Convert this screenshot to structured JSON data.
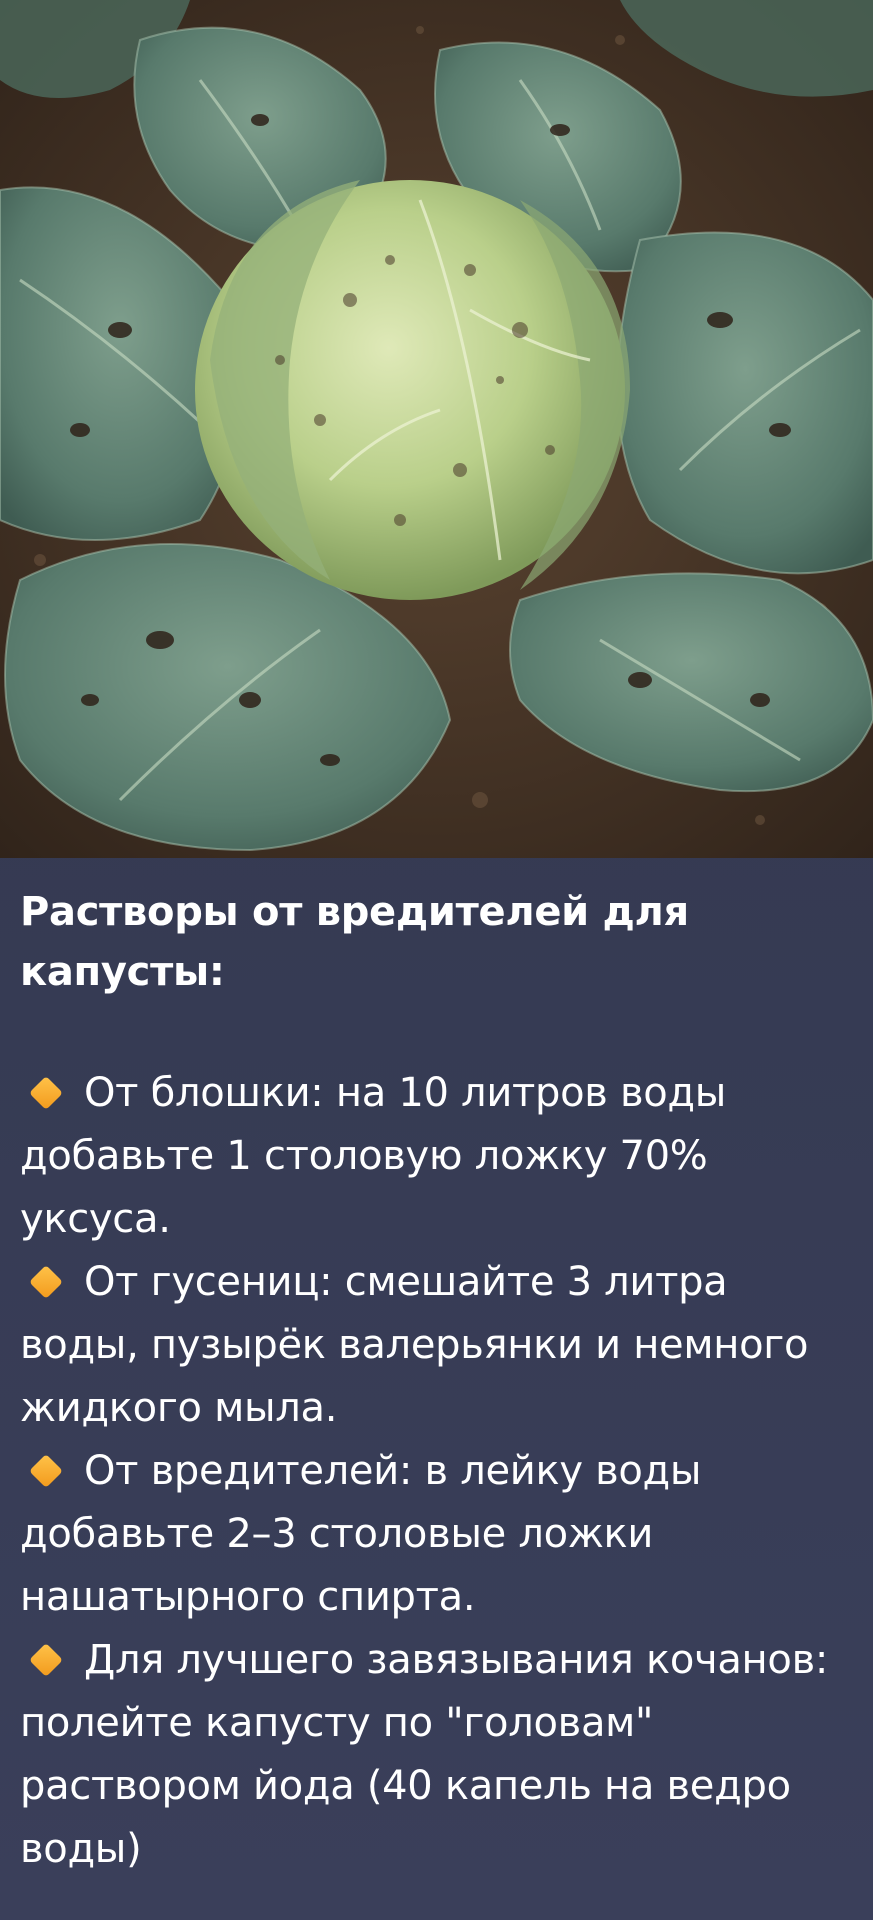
{
  "image": {
    "subject": "cabbage-photo"
  },
  "card": {
    "title": "Растворы от вредителей для капусты:",
    "items": [
      {
        "icon": "orange-diamond-icon",
        "text": "От блошки: на 10 литров воды добавьте 1 столовую ложку 70% уксуса."
      },
      {
        "icon": "orange-diamond-icon",
        "text": "От гусениц: смешайте 3 литра воды, пузырёк валерьянки и немного жидкого мыла."
      },
      {
        "icon": "orange-diamond-icon",
        "text": "От вредителей: в лейку воды добавьте 2–3 столовые ложки нашатырного спирта."
      },
      {
        "icon": "orange-diamond-icon",
        "text": "Для лучшего завязывания кочанов: полейте капусту по \"головам\" раствором йода (40 капель на ведро воды)"
      }
    ]
  },
  "colors": {
    "background": "#353a52",
    "accent": "#f5a623",
    "text": "#ffffff"
  }
}
